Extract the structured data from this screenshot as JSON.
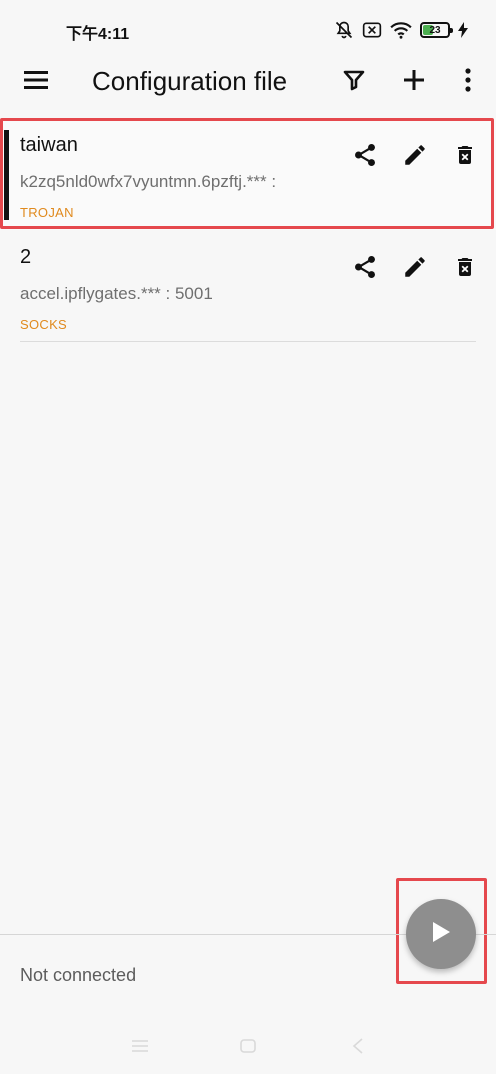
{
  "status_bar": {
    "time": "下午4:11",
    "battery_level": "23",
    "icons": [
      "mute-bell-icon",
      "sim-x-icon",
      "wifi-icon",
      "battery-icon",
      "charging-icon"
    ]
  },
  "toolbar": {
    "title": "Configuration file",
    "icons": [
      "menu-icon",
      "filter-icon",
      "add-icon",
      "more-vert-icon"
    ]
  },
  "configs": [
    {
      "name": "taiwan",
      "address": "k2zq5nld0wfx7vyuntmn.6pzftj.*** :",
      "type": "TROJAN",
      "selected": true
    },
    {
      "name": "2",
      "address": "accel.ipflygates.*** : 5001",
      "type": "SOCKS",
      "selected": false
    }
  ],
  "bottom": {
    "status": "Not connected"
  },
  "colors": {
    "background": "#f7f7f7",
    "protocol_type": "#e08a1e",
    "fab": "#8e8e8e",
    "highlight": "#e5484d",
    "selected_indicator": "#111111"
  }
}
